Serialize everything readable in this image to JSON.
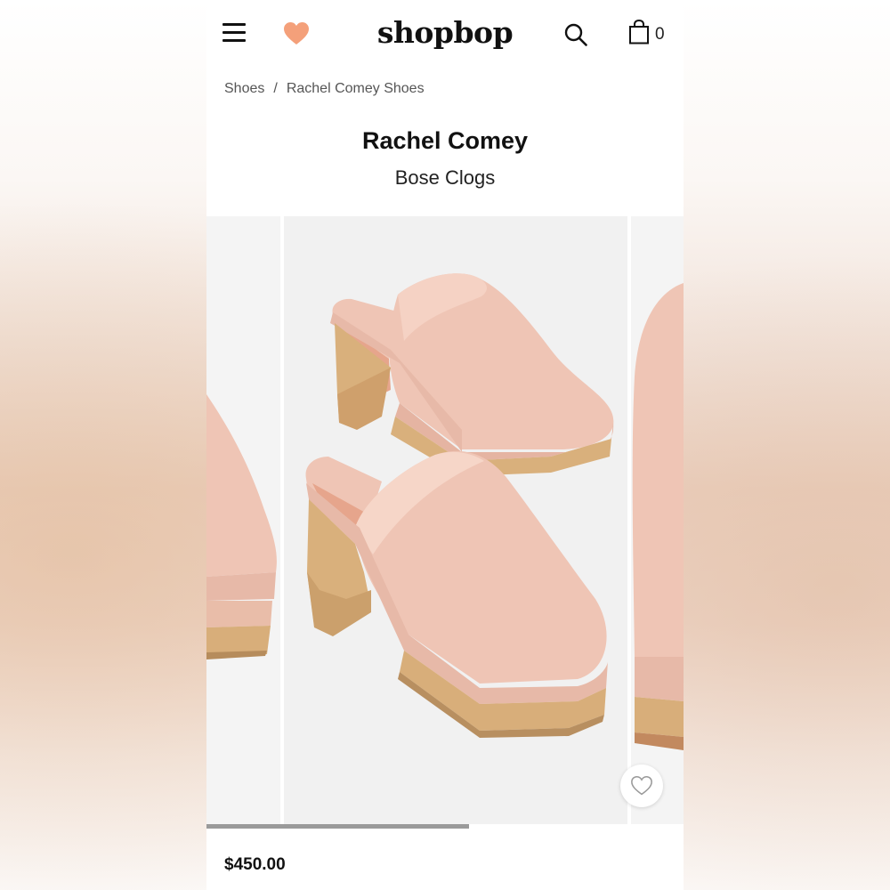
{
  "header": {
    "logo": "shopbop",
    "bag_count": "0",
    "icons": [
      "menu-icon",
      "heart-icon",
      "search-icon",
      "shopping-bag-icon"
    ],
    "accent_color": "#f4a07a"
  },
  "breadcrumb": {
    "items": [
      "Shoes",
      "Rachel Comey Shoes"
    ],
    "separator": "/"
  },
  "product": {
    "brand": "Rachel Comey",
    "name": "Bose Clogs",
    "price": "$450.00",
    "colors": {
      "leather": "#efc5b5",
      "wood": "#d8ae7a"
    }
  },
  "gallery": {
    "progress": 0.55
  }
}
